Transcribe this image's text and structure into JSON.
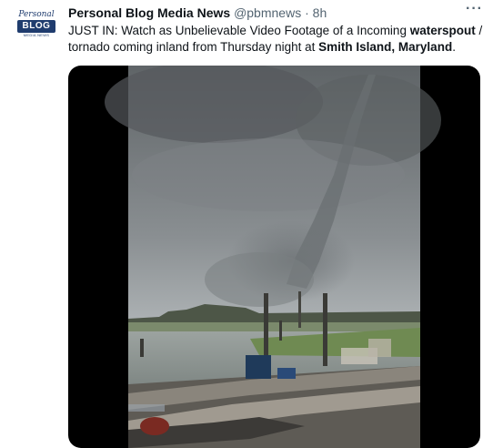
{
  "tweet": {
    "avatar": {
      "script_text": "Personal",
      "badge_text": "BLOG",
      "sub_text": "MEDIA NEWS"
    },
    "author_name": "Personal Blog Media News",
    "handle": "@pbmnews",
    "separator": "·",
    "time": "8h",
    "more_label": "···",
    "text": {
      "part1": "JUST IN: Watch as Unbelievable Video Footage of a Incoming ",
      "bold1": "waterspout",
      "part2": " / tornado coming inland from Thursday night at ",
      "bold2": "Smith Island, Maryland",
      "part3": "."
    },
    "media": {
      "icon": "video-thumbnail"
    }
  }
}
